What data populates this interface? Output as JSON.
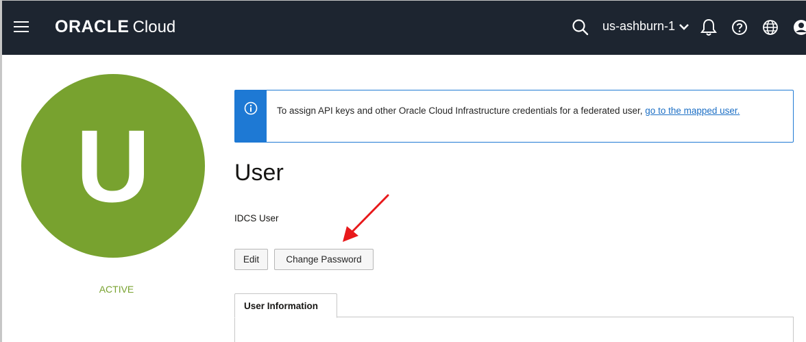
{
  "header": {
    "brand_primary": "ORACLE",
    "brand_secondary": "Cloud",
    "region": "us-ashburn-1",
    "icons": [
      "menu-icon",
      "search-icon",
      "chevron-down-icon",
      "bell-icon",
      "help-icon",
      "globe-icon",
      "profile-icon"
    ]
  },
  "profile": {
    "avatar_letter": "U",
    "status": "ACTIVE",
    "avatar_color": "#78a22f"
  },
  "banner": {
    "text": "To assign API keys and other Oracle Cloud Infrastructure credentials for a federated user, ",
    "link_text": "go to the mapped user.",
    "accent_color": "#1e79d4",
    "icon": "info-icon"
  },
  "main": {
    "title": "User",
    "subtype": "IDCS User",
    "buttons": {
      "edit": "Edit",
      "change_password": "Change Password"
    },
    "tabs": [
      {
        "label": "User Information"
      }
    ]
  },
  "annotation": {
    "icon": "red-arrow-annotation",
    "color": "#e8191b"
  }
}
